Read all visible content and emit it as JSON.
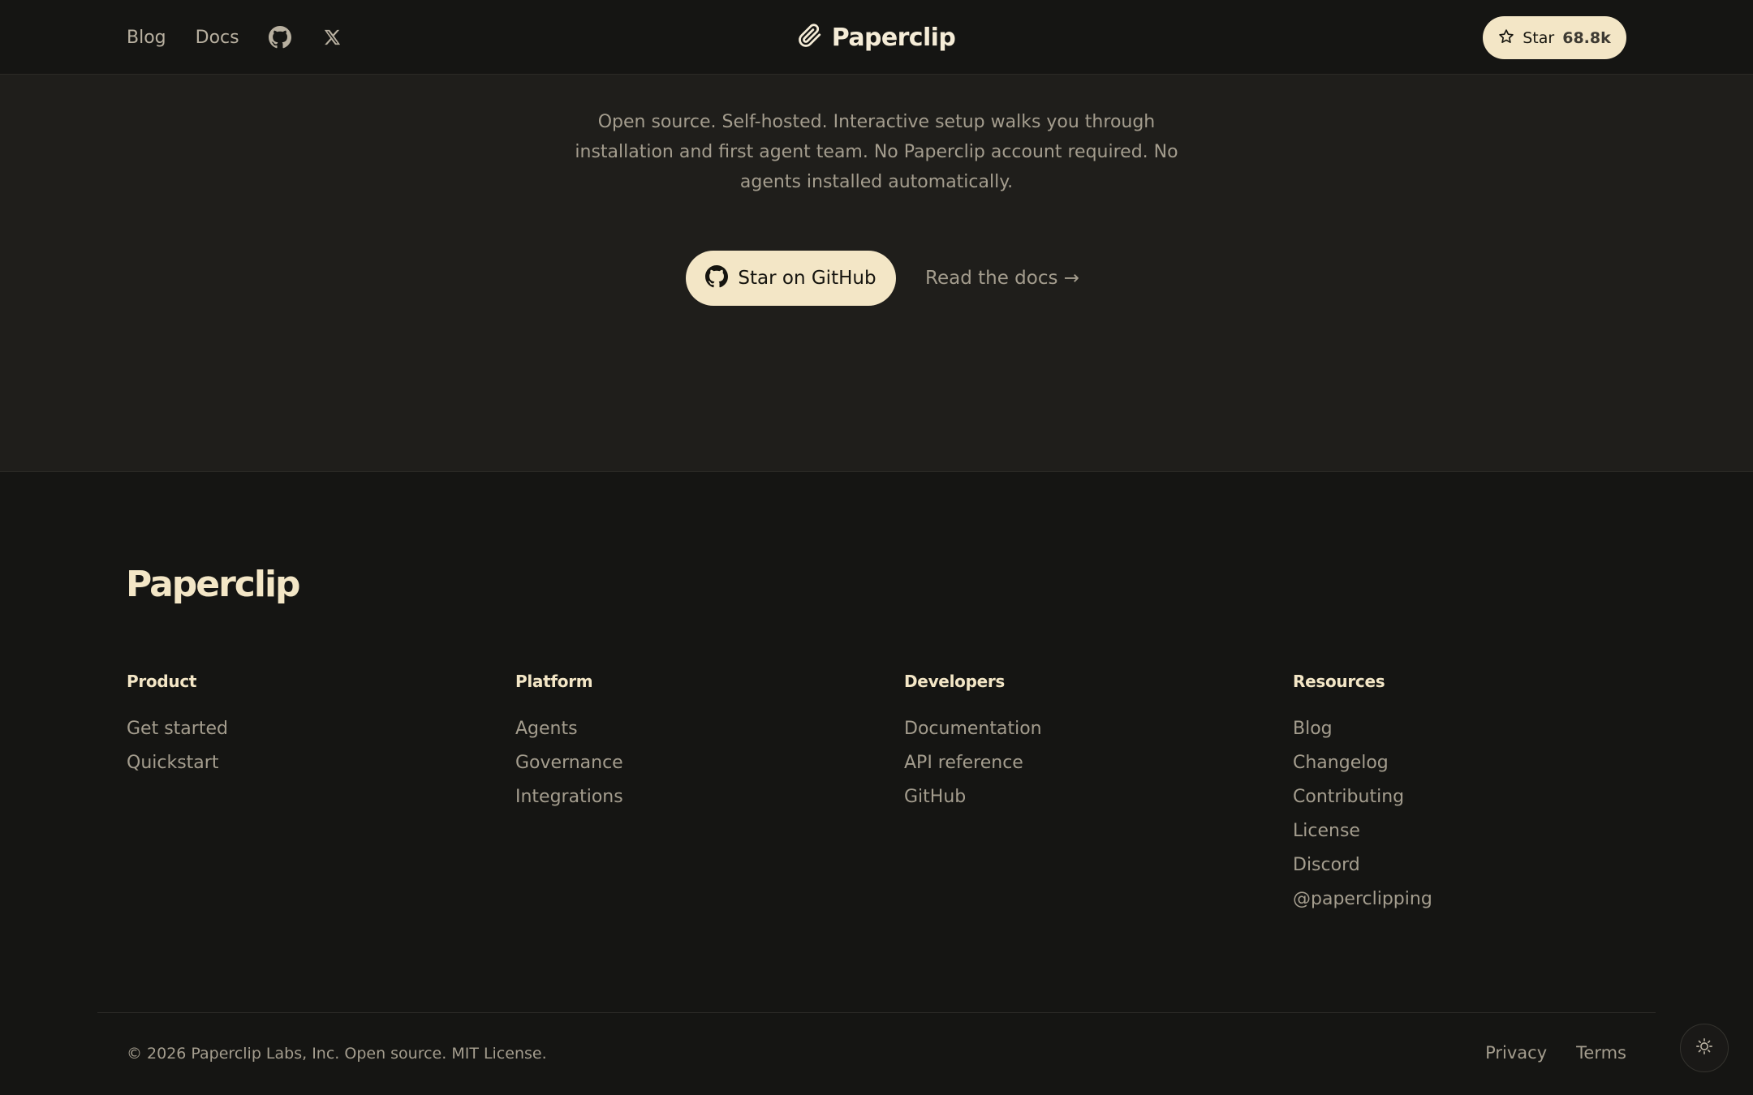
{
  "header": {
    "nav": [
      {
        "label": "Blog"
      },
      {
        "label": "Docs"
      }
    ],
    "icons": [
      "github-icon",
      "x-icon"
    ],
    "brand": "Paperclip",
    "star_button": {
      "label": "Star",
      "count": "68.8k"
    }
  },
  "cta": {
    "description": "Open source. Self-hosted. Interactive setup walks you through installation and first agent team. No Paperclip account required. No agents installed automatically.",
    "primary_button": "Star on GitHub",
    "secondary_link": "Read the docs →"
  },
  "footer": {
    "logo": "Paperclip",
    "columns": [
      {
        "title": "Product",
        "links": [
          "Get started",
          "Quickstart"
        ]
      },
      {
        "title": "Platform",
        "links": [
          "Agents",
          "Governance",
          "Integrations"
        ]
      },
      {
        "title": "Developers",
        "links": [
          "Documentation",
          "API reference",
          "GitHub"
        ]
      },
      {
        "title": "Resources",
        "links": [
          "Blog",
          "Changelog",
          "Contributing",
          "License",
          "Discord",
          "@paperclipping"
        ]
      }
    ],
    "copyright": "© 2026 Paperclip Labs, Inc. Open source. MIT License.",
    "legal": [
      "Privacy",
      "Terms"
    ]
  },
  "colors": {
    "background": "#151513",
    "section_background": "#1f1e1b",
    "accent": "#f3e6c6",
    "muted_text": "#a49d8e"
  }
}
